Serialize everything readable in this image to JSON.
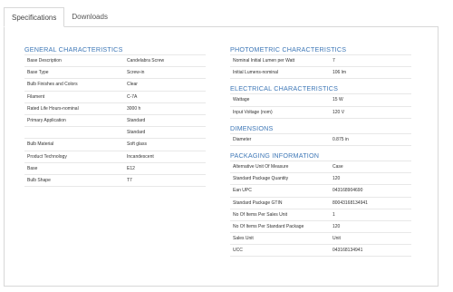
{
  "tabs": [
    {
      "label": "Specifications",
      "active": true
    },
    {
      "label": "Downloads",
      "active": false
    }
  ],
  "left_sections": [
    {
      "title": "GENERAL CHARACTERISTICS",
      "rows": [
        {
          "k": "Base Description",
          "v": "Candelabra Screw"
        },
        {
          "k": "Base Type",
          "v": "Screw-in"
        },
        {
          "k": "Bulb Finishes and Colors",
          "v": "Clear"
        },
        {
          "k": "Filament",
          "v": "C-7A"
        },
        {
          "k": "Rated Life Hours-nominal",
          "v": "3000  h"
        },
        {
          "k": "Primary Application",
          "v": "Standard"
        },
        {
          "k": "",
          "v": "Standard"
        },
        {
          "k": "Bulb Material",
          "v": "Soft glass"
        },
        {
          "k": "Product Technology",
          "v": "Incandescent"
        },
        {
          "k": "Base",
          "v": "E12"
        },
        {
          "k": "Bulb Shape",
          "v": "T7"
        }
      ]
    }
  ],
  "right_sections": [
    {
      "title": "PHOTOMETRIC CHARACTERISTICS",
      "rows": [
        {
          "k": "Nominal Initial Lumen per Watt",
          "v": "7"
        },
        {
          "k": "Initial Lumens-nominal",
          "v": "106  lm"
        }
      ]
    },
    {
      "title": "ELECTRICAL CHARACTERISTICS",
      "rows": [
        {
          "k": "Wattage",
          "v": "15  W"
        },
        {
          "k": "Input Voltage (nom)",
          "v": "120  V"
        }
      ]
    },
    {
      "title": "DIMENSIONS",
      "rows": [
        {
          "k": "Diameter",
          "v": "0.875  in"
        }
      ]
    },
    {
      "title": "PACKAGING INFORMATION",
      "rows": [
        {
          "k": "Alternative Unit Of Measure",
          "v": "Case"
        },
        {
          "k": "Standard Package Quantity",
          "v": "120"
        },
        {
          "k": "Ean UPC",
          "v": "043168904690"
        },
        {
          "k": "Standard Package GTIN",
          "v": "80043168134941"
        },
        {
          "k": "No Of Items Per Sales Unit",
          "v": "1"
        },
        {
          "k": "No Of Items Per Standard Package",
          "v": "120"
        },
        {
          "k": "Sales Unit",
          "v": "Unit"
        },
        {
          "k": "UCC",
          "v": "043168134941"
        }
      ]
    }
  ]
}
